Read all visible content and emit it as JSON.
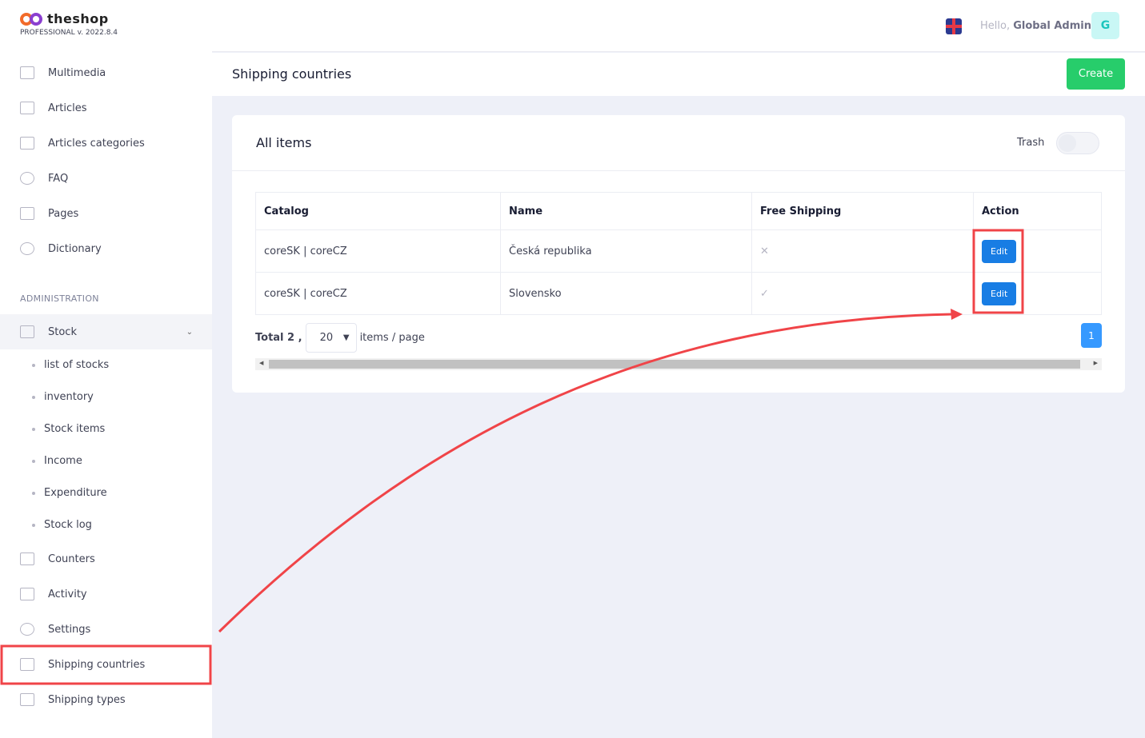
{
  "brand": {
    "name": "theshop",
    "edition": "PROFESSIONAL",
    "version": "v. 2022.8.4"
  },
  "sidebar": {
    "items": [
      {
        "label": "Multimedia",
        "icon": "image-icon"
      },
      {
        "label": "Articles",
        "icon": "edit-icon"
      },
      {
        "label": "Articles categories",
        "icon": "copy-icon"
      },
      {
        "label": "FAQ",
        "icon": "lifebuoy-icon"
      },
      {
        "label": "Pages",
        "icon": "window-icon"
      },
      {
        "label": "Dictionary",
        "icon": "globe-icon"
      }
    ],
    "section": "ADMINISTRATION",
    "stock": {
      "label": "Stock",
      "children": [
        "list of stocks",
        "inventory",
        "Stock items",
        "Income",
        "Expenditure",
        "Stock log"
      ]
    },
    "admin_items": [
      {
        "label": "Counters",
        "icon": "list-icon"
      },
      {
        "label": "Activity",
        "icon": "calendar-icon"
      },
      {
        "label": "Settings",
        "icon": "gear-icon"
      },
      {
        "label": "Shipping countries",
        "icon": "map-pin-icon"
      },
      {
        "label": "Shipping types",
        "icon": "truck-icon"
      }
    ]
  },
  "topbar": {
    "hello": "Hello,",
    "user": "Global Admin",
    "avatar": "G"
  },
  "header": {
    "title": "Shipping countries",
    "create": "Create"
  },
  "card": {
    "title": "All items",
    "trash": "Trash",
    "trash_on": false
  },
  "table": {
    "columns": [
      "Catalog",
      "Name",
      "Free Shipping",
      "Action"
    ],
    "rows": [
      {
        "catalog": "coreSK | coreCZ",
        "name": "Česká republika",
        "free": "✕",
        "action": "Edit"
      },
      {
        "catalog": "coreSK | coreCZ",
        "name": "Slovensko",
        "free": "✓",
        "action": "Edit"
      }
    ]
  },
  "pagination": {
    "total": "Total 2 ,",
    "per_page": "20",
    "suffix": "items / page",
    "page": "1"
  },
  "annotation_color": "#f04448"
}
